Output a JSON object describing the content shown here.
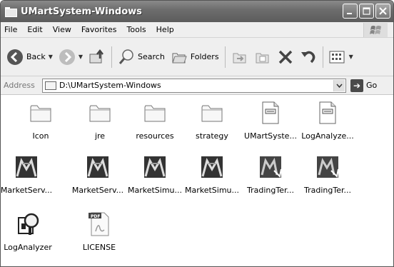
{
  "window": {
    "title": "UMartSystem-Windows",
    "controls": {
      "minimize": "_",
      "maximize": "□",
      "close": "✕"
    }
  },
  "menu": [
    "File",
    "Edit",
    "View",
    "Favorites",
    "Tools",
    "Help"
  ],
  "toolbar": {
    "back": "Back",
    "search": "Search",
    "folders": "Folders"
  },
  "address": {
    "label": "Address",
    "value": "D:\\UMartSystem-Windows",
    "go": "Go"
  },
  "items": [
    {
      "label": "Icon",
      "icon": "folder-icon"
    },
    {
      "label": "jre",
      "icon": "folder-icon"
    },
    {
      "label": "resources",
      "icon": "folder-icon"
    },
    {
      "label": "strategy",
      "icon": "folder-icon"
    },
    {
      "label": "UMartSyste...",
      "icon": "document-icon"
    },
    {
      "label": "LogAnalyze...",
      "icon": "document-icon"
    },
    {
      "label": "MarketServ...",
      "icon": "umart-app-icon"
    },
    {
      "label": "MarketServ...",
      "icon": "umart-app-icon"
    },
    {
      "label": "MarketSimu...",
      "icon": "umart-app-icon"
    },
    {
      "label": "MarketSimu...",
      "icon": "umart-app-icon"
    },
    {
      "label": "TradingTer...",
      "icon": "umart-trading-icon"
    },
    {
      "label": "TradingTer...",
      "icon": "umart-trading-icon"
    },
    {
      "label": "LogAnalyzer",
      "icon": "log-analyzer-icon"
    },
    {
      "label": "LICENSE",
      "icon": "pdf-icon"
    }
  ]
}
